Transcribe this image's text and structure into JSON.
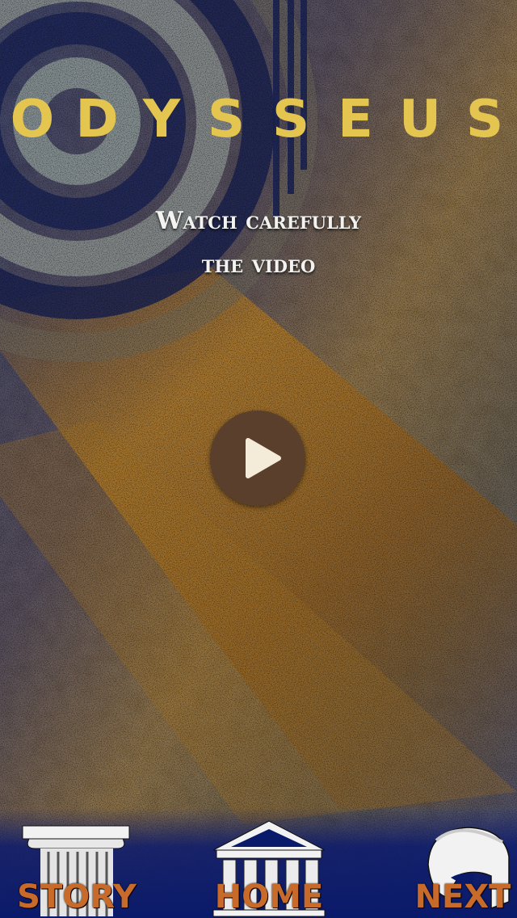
{
  "title": "ODYSSEUS",
  "instruction": {
    "line1": "Watch carefully",
    "line2": "the video"
  },
  "play_button": {
    "icon": "play-icon"
  },
  "nav": {
    "story": {
      "label": "STORY",
      "icon": "column-icon"
    },
    "home": {
      "label": "HOME",
      "icon": "temple-icon"
    },
    "next": {
      "label": "NEXT",
      "icon": "helmet-icon"
    }
  },
  "colors": {
    "title": "#e3c550",
    "nav_label": "#c86a2a",
    "play_bg": "#5a3f2c",
    "play_arrow": "#f4ecd8",
    "nav_bar": "#0a1a6a"
  }
}
